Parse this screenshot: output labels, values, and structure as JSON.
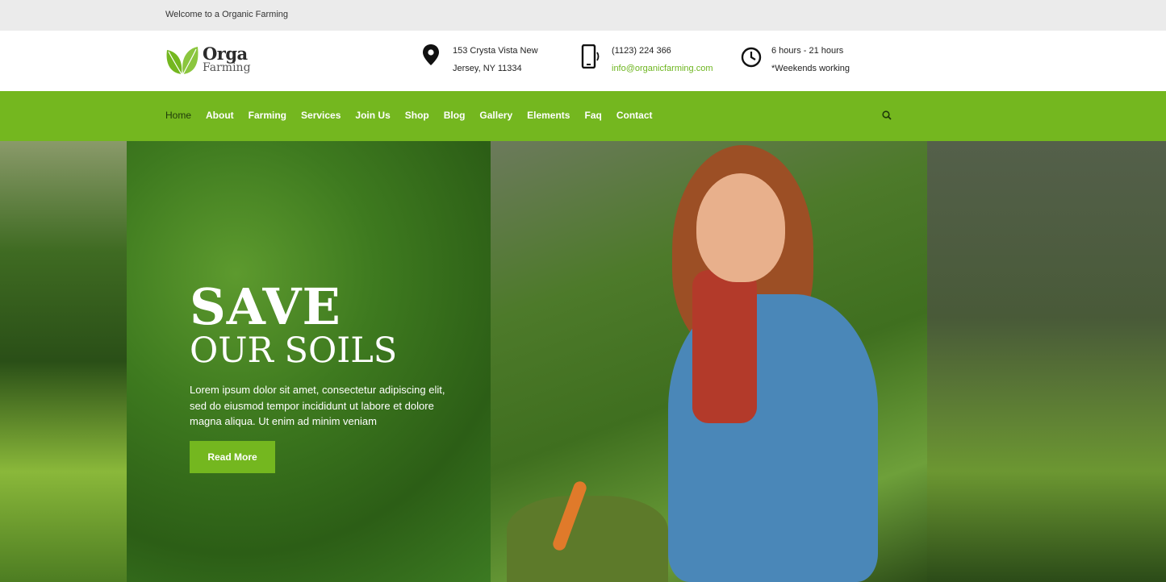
{
  "topbar": {
    "welcome": "Welcome to a Organic Farming"
  },
  "logo": {
    "brand": "Orga",
    "sub": "Farming"
  },
  "contact": {
    "address_line1": "153 Crysta Vista New",
    "address_line2": "Jersey, NY 11334",
    "phone": "(1123) 224 366",
    "email": "info@organicfarming.com",
    "hours": "6 hours - 21 hours",
    "hours_note": "*Weekends working"
  },
  "nav": {
    "items": [
      "Home",
      "About",
      "Farming",
      "Services",
      "Join Us",
      "Shop",
      "Blog",
      "Gallery",
      "Elements",
      "Faq",
      "Contact"
    ],
    "active": "Home"
  },
  "hero": {
    "title_line1": "SAVE",
    "title_line2": "OUR SOILS",
    "body": "Lorem ipsum dolor sit amet, consectetur adipiscing elit, sed do eiusmod tempor incididunt ut labore et dolore magna aliqua. Ut enim ad minim veniam",
    "button": "Read More"
  },
  "colors": {
    "accent": "#74b71f",
    "topbar": "#ebebeb",
    "link_green": "#6db51f"
  },
  "icons": {
    "logo": "leaf-icon",
    "address": "map-pin-icon",
    "phone": "mobile-phone-icon",
    "hours": "clock-icon",
    "search": "search-icon"
  }
}
